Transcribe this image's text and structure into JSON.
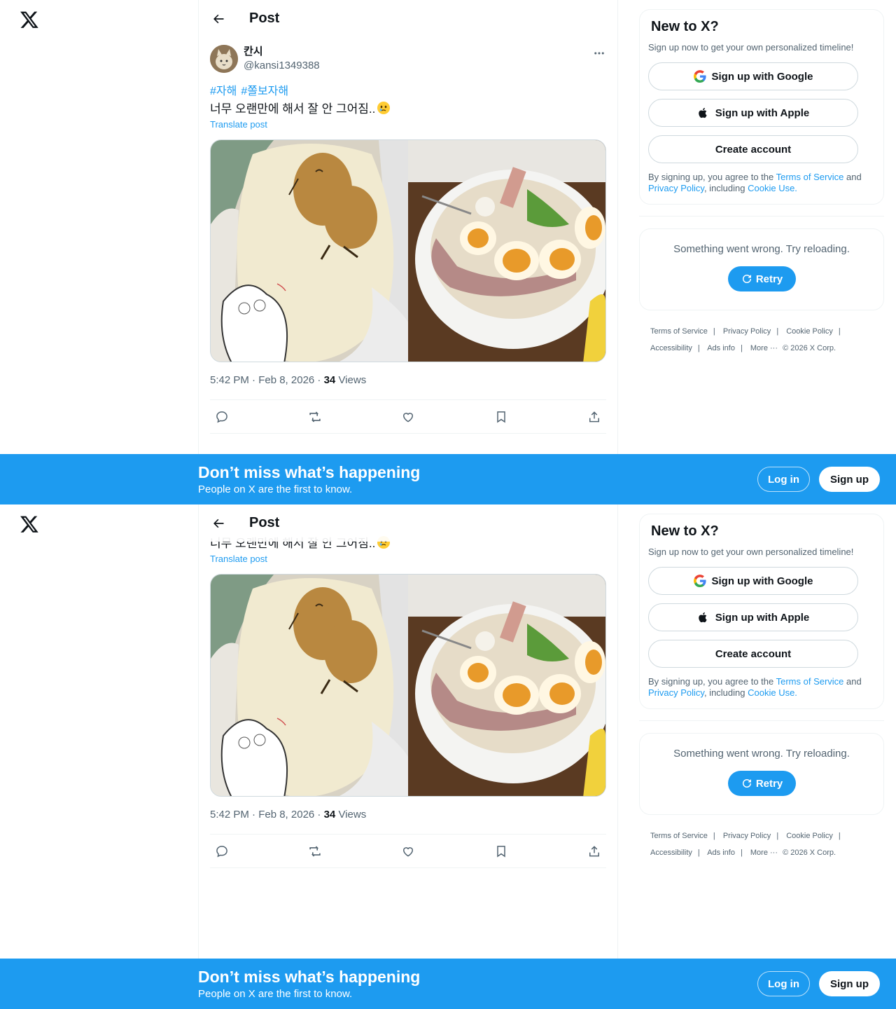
{
  "header": {
    "title": "Post"
  },
  "post": {
    "display_name": "칸시",
    "handle": "@kansi1349388",
    "hashtags": [
      "#자해",
      "#쫄보자해"
    ],
    "text": "너무 오랜만에 해서 잘 안 그어짐..",
    "translate_label": "Translate post",
    "time": "5:42 PM · Feb 8, 2026 · ",
    "views_count": "34",
    "views_label": " Views"
  },
  "sidebar": {
    "signup_title": "New to X?",
    "signup_sub": "Sign up now to get your own personalized timeline!",
    "google_label": "Sign up with Google",
    "apple_label": "Sign up with Apple",
    "create_label": "Create account",
    "fine_prefix": "By signing up, you agree to the ",
    "tos_link": "Terms of Service",
    "and_text": " and ",
    "privacy_link": "Privacy Policy",
    "including_text": ", including ",
    "cookie_link": "Cookie Use.",
    "error_text": "Something went wrong. Try reloading.",
    "retry_label": "Retry"
  },
  "footer": {
    "terms": "Terms of Service",
    "privacy": "Privacy Policy",
    "cookie": "Cookie Policy",
    "accessibility": "Accessibility",
    "ads": "Ads info",
    "more": "More ···",
    "copyright": "© 2026 X Corp."
  },
  "banner": {
    "title": "Don’t miss what’s happening",
    "subtitle": "People on X are the first to know.",
    "login_label": "Log in",
    "signup_label": "Sign up"
  },
  "colors": {
    "accent": "#1d9bf0",
    "muted": "#536471",
    "border": "#eff3f4"
  }
}
